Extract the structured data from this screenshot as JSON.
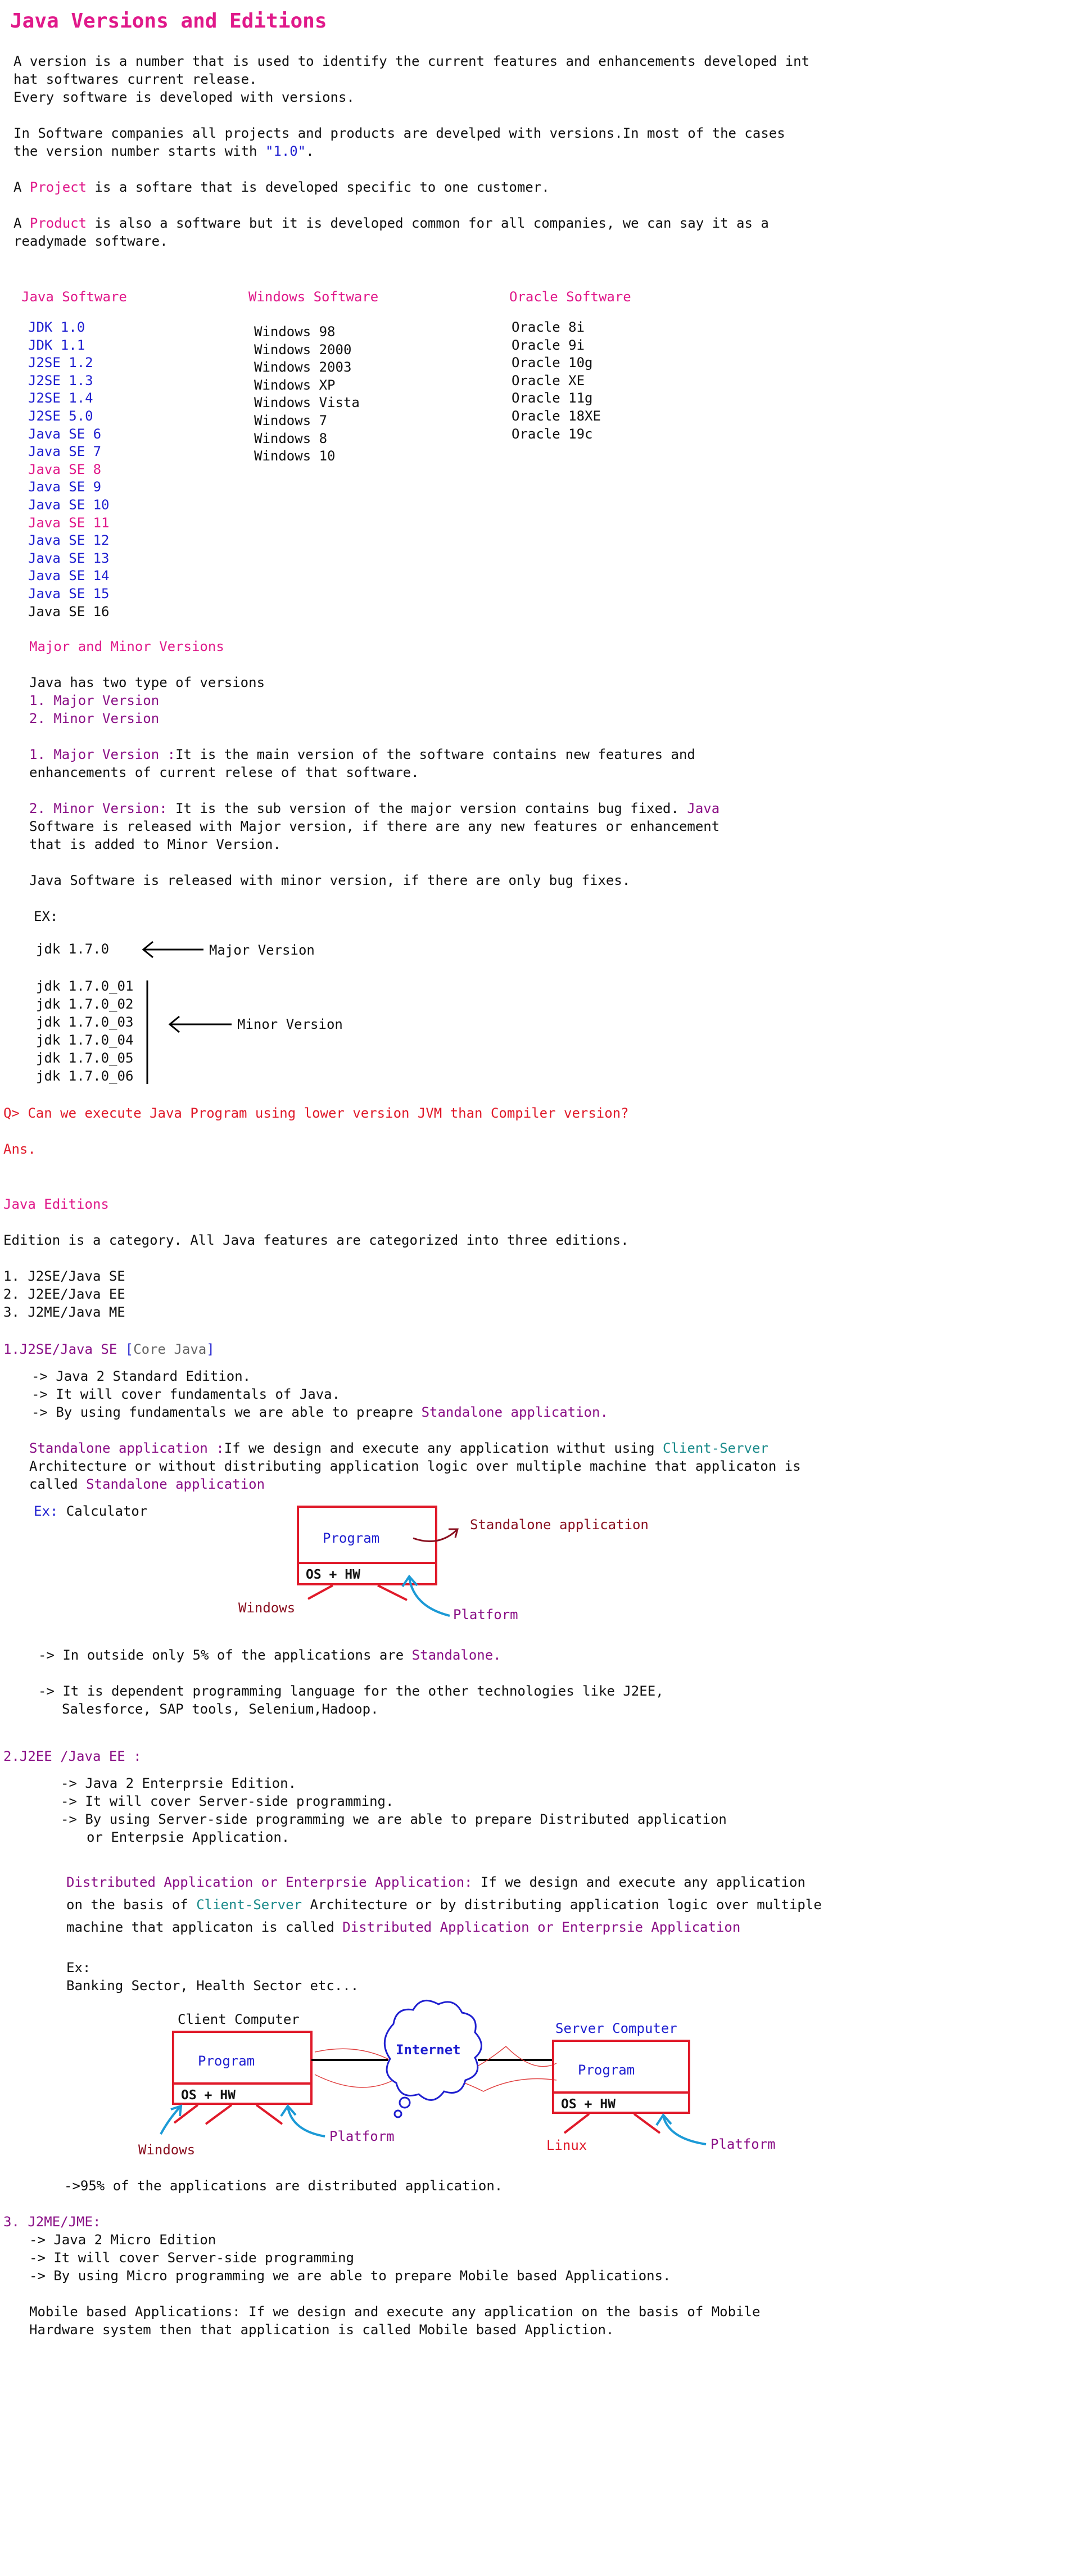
{
  "title": "Java Versions and Editions",
  "intro": {
    "line1": "A version is a number that is used to identify the current features and enhancements developed int",
    "line2": "hat softwares current release.",
    "line3": "Every software is developed with versions.",
    "line4": "In Software companies all projects and products are develped with versions.In most of the cases",
    "line5_pre": "the version number starts with ",
    "line5_version": "\"1.0\"",
    "line5_post": ".",
    "project_pre": "A ",
    "project_word": "Project",
    "project_post": " is a softare that is developed specific to one customer.",
    "product_pre": "A ",
    "product_word": "Product",
    "product_post": " is also a software but it is developed common for all companies, we can say it as a",
    "product_line2": "readymade software."
  },
  "columns": {
    "java": {
      "header": "Java Software",
      "items": [
        {
          "text": "JDK  1.0",
          "color": "blue"
        },
        {
          "text": "JDK  1.1",
          "color": "blue"
        },
        {
          "text": "J2SE 1.2",
          "color": "blue"
        },
        {
          "text": "J2SE 1.3",
          "color": "blue"
        },
        {
          "text": "J2SE 1.4",
          "color": "blue"
        },
        {
          "text": "J2SE 5.0",
          "color": "blue"
        },
        {
          "text": "Java SE 6",
          "color": "blue"
        },
        {
          "text": "Java SE 7",
          "color": "blue"
        },
        {
          "text": "Java SE 8",
          "color": "pink"
        },
        {
          "text": "Java SE 9",
          "color": "blue"
        },
        {
          "text": "Java SE 10",
          "color": "blue"
        },
        {
          "text": "Java SE 11",
          "color": "pink"
        },
        {
          "text": "Java SE 12",
          "color": "blue"
        },
        {
          "text": "Java SE 13",
          "color": "blue"
        },
        {
          "text": "Java SE 14",
          "color": "blue"
        },
        {
          "text": "Java SE 15",
          "color": "blue"
        },
        {
          "text": "Java SE 16",
          "color": "black"
        }
      ]
    },
    "windows": {
      "header": "Windows Software",
      "items": [
        "Windows 98",
        "Windows 2000",
        "Windows 2003",
        "Windows XP",
        "Windows Vista",
        "Windows 7",
        "Windows 8",
        "Windows 10"
      ]
    },
    "oracle": {
      "header": "Oracle Software",
      "items": [
        "Oracle 8i",
        "Oracle 9i",
        "Oracle 10g",
        "Oracle XE",
        "Oracle 11g",
        "Oracle 18XE",
        "Oracle 19c"
      ]
    }
  },
  "versions": {
    "heading": "Major and Minor Versions",
    "types_intro": "Java has two type of versions",
    "type1": "1. Major Version",
    "type2": "2. Minor Version",
    "major_label": "1. Major Version :",
    "major_text": "It is the main version of the software contains new features and",
    "major_text2": "enhancements of current relese of that software.",
    "minor_label": "2. Minor Version:",
    "minor_text": " It is the sub version of the major version  contains  bug fixed. ",
    "minor_java": "Java",
    "minor_text2": "Software is released with Major version, if there are any new features or enhancement",
    "minor_text3": "that is added to Minor Version.",
    "bugfix": "Java Software is released with minor version, if there are only bug fixes.",
    "ex": "EX:",
    "major_example": "jdk 1.7.0",
    "major_arrow_label": "Major Version",
    "minor_examples": [
      "jdk 1.7.0_01",
      "jdk 1.7.0_02",
      "jdk 1.7.0_03",
      "jdk 1.7.0_04",
      "jdk 1.7.0_05",
      "jdk 1.7.0_06"
    ],
    "minor_arrow_label": "Minor Version"
  },
  "question": "Q> Can we execute Java Program using lower version JVM than Compiler version?",
  "answer": "Ans.",
  "editions": {
    "heading": "Java Editions",
    "intro": "Edition is a category. All Java features are categorized into three editions.",
    "list": [
      "1. J2SE/Java SE",
      "2. J2EE/Java EE",
      "3. J2ME/Java ME"
    ],
    "j2se": {
      "heading": "1.J2SE/Java SE ",
      "bracket_open": "[",
      "core": "Core Java",
      "bracket_close": "]",
      "bullets": [
        "-> Java 2 Standard Edition.",
        "-> It will cover fundamentals of Java."
      ],
      "bullet3_pre": "-> By using fundamentals we are able to preapre ",
      "bullet3_hl": "Standalone application.",
      "def_label": "Standalone application :",
      "def_text": "If we design and execute any application withut using ",
      "def_cs": "Client-Server",
      "def_line2": "Architecture or without distributing application logic over multiple machine that applicaton is",
      "def_line3_pre": "called ",
      "def_line3_hl": "Standalone application",
      "ex_label": "Ex:",
      "ex_text": " Calculator",
      "diagram": {
        "program": "Program",
        "os_hw": "OS  +  HW",
        "standalone_label": "Standalone application",
        "windows": "Windows",
        "platform": "Platform"
      },
      "note1_pre": "-> In outside only 5% of the applications are ",
      "note1_hl": "Standalone.",
      "note2": "-> It is dependent programming language for the other technologies like J2EE,",
      "note2b": "Salesforce, SAP tools, Selenium,Hadoop."
    },
    "j2ee": {
      "heading": "2.J2EE /Java EE :",
      "bullets": [
        "-> Java 2 Enterprsie Edition.",
        "-> It will cover Server-side programming.",
        "-> By using Server-side programming we are able to prepare Distributed application"
      ],
      "bullet3b": "or Enterpsie Application.",
      "def_label": "Distributed Application or Enterprsie Application:",
      "def_text": " If we design and execute any application",
      "def_line2_pre": "on the basis of ",
      "def_cs": "Client-Server",
      "def_line2_post": " Architecture or  by  distributing application logic over  multiple",
      "def_line3_pre": "machine that applicaton is called ",
      "def_line3_hl": "Distributed Application or Enterprsie Application",
      "ex_label": "Ex:",
      "ex_text": "Banking Sector, Health Sector etc...",
      "diagram": {
        "client_label": "Client Computer",
        "server_label": "Server Computer",
        "program": "Program",
        "os_hw": "OS  +  HW",
        "internet": "Internet",
        "windows": "Windows",
        "linux": "Linux",
        "platform": "Platform"
      },
      "note": "->95% of the applications are distributed application."
    },
    "j2me": {
      "heading": "3. J2ME/JME:",
      "bullets": [
        "-> Java 2 Micro Edition",
        "-> It will cover Server-side programming",
        "-> By using Micro programming we are able to prepare Mobile based Applications."
      ],
      "def_line1": "Mobile based Applications: If we design and execute any application on the basis of Mobile",
      "def_line2": "Hardware system then that application is called Mobile based Appliction."
    }
  }
}
